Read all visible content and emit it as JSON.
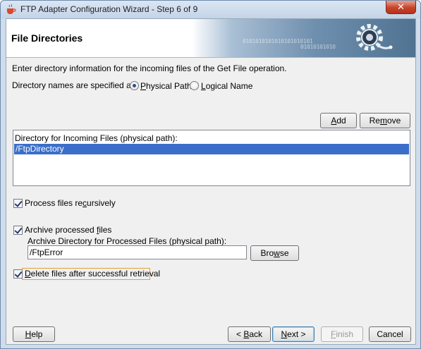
{
  "window": {
    "title": "FTP Adapter Configuration Wizard - Step 6 of 9",
    "close_label": "✕"
  },
  "header": {
    "title": "File Directories",
    "binary_line1": "0101010101010101010101",
    "binary_line2": "01010101010"
  },
  "intro_text": "Enter directory information for the incoming files of the Get File operation.",
  "directory_names": {
    "label": "Directory names are specified as:",
    "options": [
      {
        "label_before": "",
        "mnemonic": "P",
        "label_after": "hysical Path",
        "selected": true
      },
      {
        "label_before": "",
        "mnemonic": "L",
        "label_after": "ogical Name",
        "selected": false
      }
    ]
  },
  "buttons": {
    "add": {
      "mnemonic": "A",
      "rest": "dd"
    },
    "remove": {
      "before": "Re",
      "mnemonic": "m",
      "rest": "ove"
    },
    "browse": {
      "before": "Bro",
      "mnemonic": "w",
      "rest": "se"
    },
    "help": {
      "mnemonic": "H",
      "rest": "elp"
    },
    "back": {
      "before": "< ",
      "mnemonic": "B",
      "rest": "ack"
    },
    "next": {
      "mnemonic": "N",
      "rest": "ext >"
    },
    "finish": {
      "mnemonic": "F",
      "rest": "inish"
    },
    "cancel": "Cancel"
  },
  "incoming_list": {
    "header": "Directory for Incoming Files (physical path):",
    "items": [
      "/FtpDirectory"
    ]
  },
  "options": {
    "recursive": {
      "checked": true,
      "before": "Process files re",
      "mnemonic": "c",
      "rest": "ursively"
    },
    "archive": {
      "checked": true,
      "before": "Archive processed ",
      "mnemonic": "f",
      "rest": "iles"
    },
    "delete": {
      "checked": true,
      "before": "",
      "mnemonic": "D",
      "rest": "elete files after successful retrieval"
    }
  },
  "archive_dir": {
    "label": "Archive Directory for Processed Files (physical path):",
    "value": "/FtpError"
  },
  "colors": {
    "selection": "#3a6ec9",
    "window_frame": "#cfdcec"
  }
}
